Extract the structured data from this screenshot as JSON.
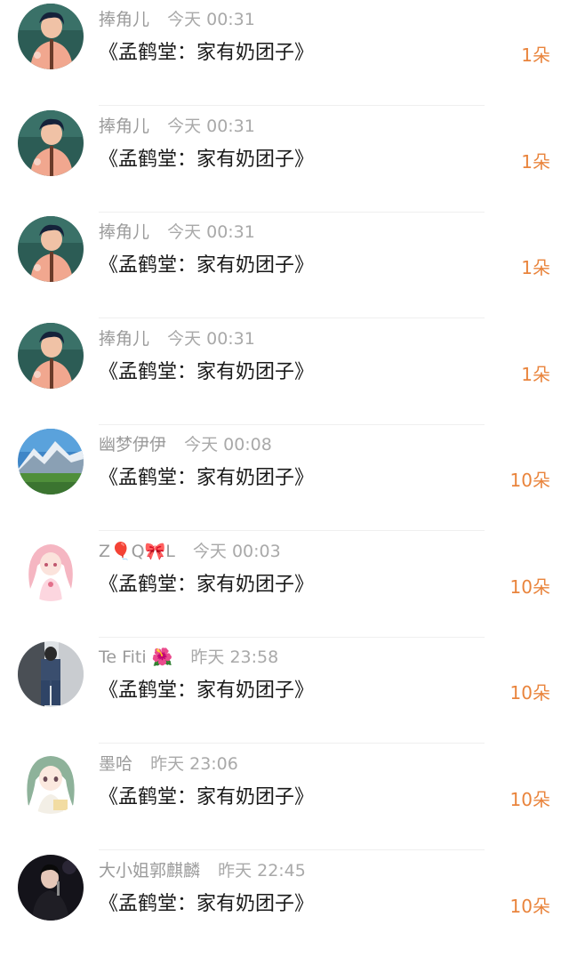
{
  "gift_list": {
    "items": [
      {
        "name": "捧角儿",
        "time": "今天 00:31",
        "gift": "《孟鹤堂：家有奶团子》",
        "count": "1朵",
        "avatar": "performer-red-jacket"
      },
      {
        "name": "捧角儿",
        "time": "今天 00:31",
        "gift": "《孟鹤堂：家有奶团子》",
        "count": "1朵",
        "avatar": "performer-red-jacket"
      },
      {
        "name": "捧角儿",
        "time": "今天 00:31",
        "gift": "《孟鹤堂：家有奶团子》",
        "count": "1朵",
        "avatar": "performer-red-jacket"
      },
      {
        "name": "捧角儿",
        "time": "今天 00:31",
        "gift": "《孟鹤堂：家有奶团子》",
        "count": "1朵",
        "avatar": "performer-red-jacket"
      },
      {
        "name": "幽梦伊伊",
        "time": "今天 00:08",
        "gift": "《孟鹤堂：家有奶团子》",
        "count": "10朵",
        "avatar": "mountain-landscape"
      },
      {
        "name": "Z🎈Q🎀L",
        "time": "今天 00:03",
        "gift": "《孟鹤堂：家有奶团子》",
        "count": "10朵",
        "avatar": "anime-pink-hair-girl"
      },
      {
        "name": "Te Fiti 🌺",
        "time": "昨天 23:58",
        "gift": "《孟鹤堂：家有奶团子》",
        "count": "10朵",
        "avatar": "person-in-blue-jeans"
      },
      {
        "name": "墨哈",
        "time": "昨天 23:06",
        "gift": "《孟鹤堂：家有奶团子》",
        "count": "10朵",
        "avatar": "anime-green-hair-girl"
      },
      {
        "name": "大小姐郭麒麟",
        "time": "昨天 22:45",
        "gift": "《孟鹤堂：家有奶团子》",
        "count": "10朵",
        "avatar": "performer-on-stage-dark"
      }
    ]
  },
  "colors": {
    "count_accent": "#e9843c",
    "meta_text": "#9b9b9b",
    "gift_text": "#1a1a1a",
    "divider": "#efefef"
  }
}
